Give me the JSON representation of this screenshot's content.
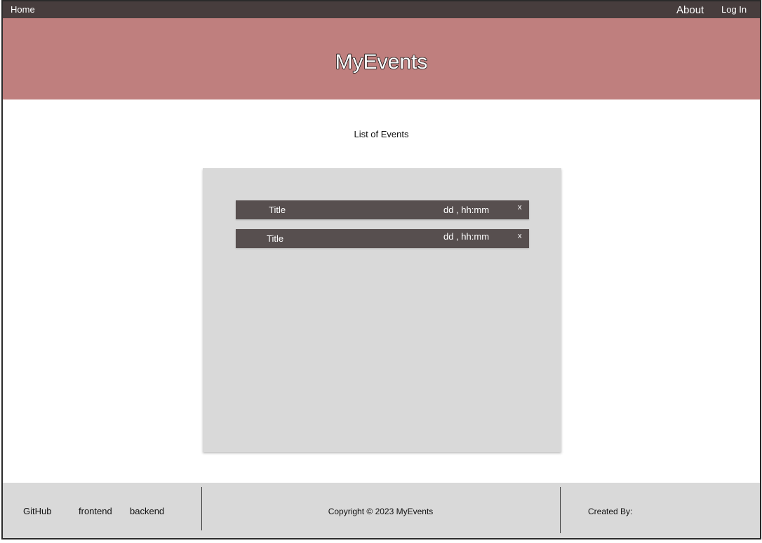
{
  "navbar": {
    "home_label": "Home",
    "about_label": "About",
    "login_label": "Log In"
  },
  "hero": {
    "title": "MyEvents"
  },
  "main": {
    "heading": "List of Events",
    "events": [
      {
        "title": "Title",
        "time": "dd , hh:mm",
        "delete_label": "x"
      },
      {
        "title": "Title",
        "time": "dd , hh:mm",
        "delete_label": "x"
      }
    ]
  },
  "footer": {
    "links": [
      "GitHub",
      "frontend",
      "backend"
    ],
    "copyright": "Copyright © 2023 MyEvents",
    "created_by": "Created By:"
  },
  "colors": {
    "navbar_bg": "#473d3d",
    "hero_bg": "#bf7f7e",
    "panel_bg": "#d9d9d9",
    "event_row_bg": "#574f4f",
    "footer_bg": "#d9d9d9"
  }
}
